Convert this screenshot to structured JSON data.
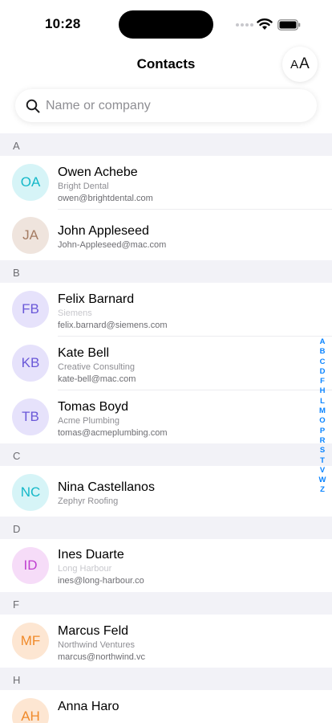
{
  "status": {
    "time": "10:28"
  },
  "nav": {
    "title": "Contacts",
    "text_size_small": "A",
    "text_size_large": "A"
  },
  "search": {
    "placeholder": "Name or company",
    "value": ""
  },
  "sections": [
    {
      "letter": "A",
      "contacts": [
        {
          "initials": "OA",
          "name": "Owen Achebe",
          "company": "Bright Dental",
          "email": "owen@brightdental.com"
        },
        {
          "initials": "JA",
          "name": "John Appleseed",
          "company": "",
          "email": "John-Appleseed@mac.com"
        }
      ]
    },
    {
      "letter": "B",
      "contacts": [
        {
          "initials": "FB",
          "name": "Felix Barnard",
          "company": "Siemens",
          "email": "felix.barnard@siemens.com"
        },
        {
          "initials": "KB",
          "name": "Kate Bell",
          "company": "Creative Consulting",
          "email": "kate-bell@mac.com"
        },
        {
          "initials": "TB",
          "name": "Tomas Boyd",
          "company": "Acme Plumbing",
          "email": "tomas@acmeplumbing.com"
        }
      ]
    },
    {
      "letter": "C",
      "contacts": [
        {
          "initials": "NC",
          "name": "Nina Castellanos",
          "company": "Zephyr Roofing",
          "email": ""
        }
      ]
    },
    {
      "letter": "D",
      "contacts": [
        {
          "initials": "ID",
          "name": "Ines Duarte",
          "company": "Long Harbour",
          "email": "ines@long-harbour.co"
        }
      ]
    },
    {
      "letter": "F",
      "contacts": [
        {
          "initials": "MF",
          "name": "Marcus Feld",
          "company": "Northwind Ventures",
          "email": "marcus@northwind.vc"
        }
      ]
    },
    {
      "letter": "H",
      "contacts": [
        {
          "initials": "AH",
          "name": "Anna Haro",
          "company": "",
          "email": ""
        }
      ]
    }
  ],
  "index_letters": [
    "A",
    "B",
    "C",
    "D",
    "F",
    "H",
    "L",
    "M",
    "O",
    "P",
    "R",
    "S",
    "T",
    "V",
    "W",
    "Z"
  ],
  "colors": {
    "accent": "#0a84ff",
    "avatar_cyan_bg": "#d6f4f7",
    "avatar_cyan_fg": "#14b8c8",
    "avatar_tan_bg": "#efe4dd",
    "avatar_tan_fg": "#a47b62",
    "avatar_purple_bg": "#e6e2fb",
    "avatar_purple_fg": "#6a58d8",
    "avatar_magenta_bg": "#f6dcf8",
    "avatar_magenta_fg": "#c03fd0",
    "avatar_orange_bg": "#fde6d2",
    "avatar_orange_fg": "#f08a2a"
  }
}
